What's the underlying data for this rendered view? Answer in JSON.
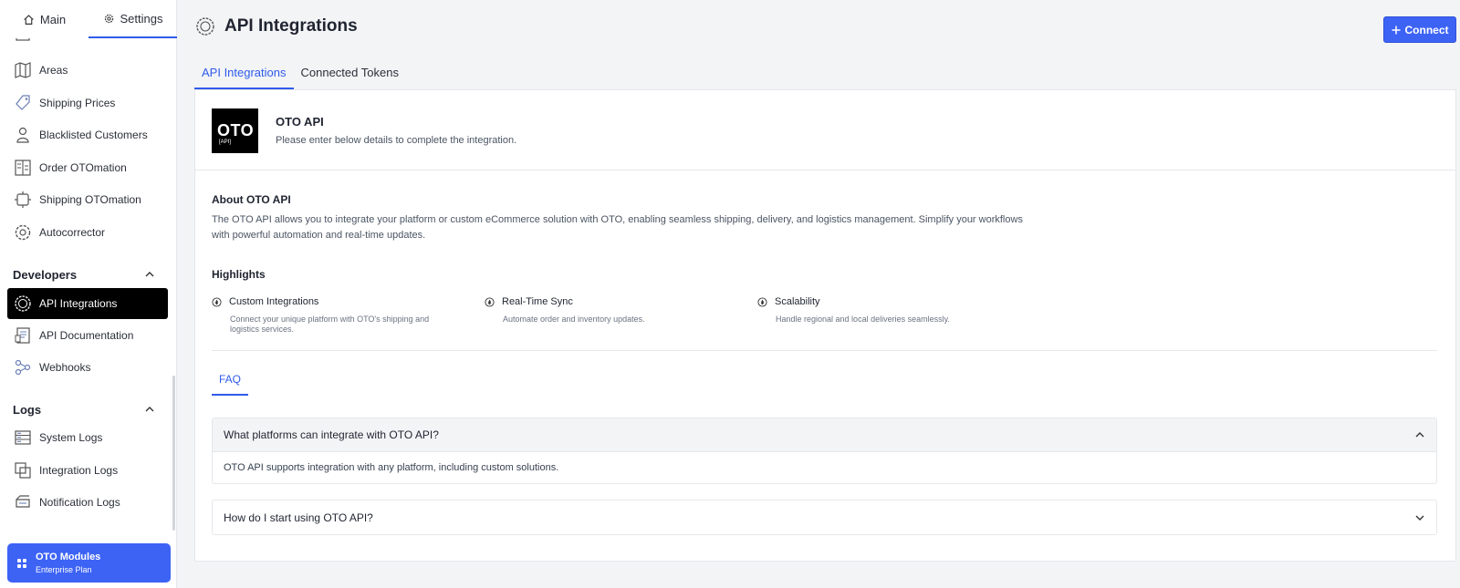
{
  "sidebar": {
    "tabs": [
      {
        "label": "Main",
        "icon": "home-icon",
        "active": false
      },
      {
        "label": "Settings",
        "icon": "gear-icon",
        "active": true
      }
    ],
    "items": [
      {
        "label": "Areas",
        "icon": "map-icon"
      },
      {
        "label": "Shipping Prices",
        "icon": "price-tag-icon"
      },
      {
        "label": "Blacklisted Customers",
        "icon": "user-block-icon"
      },
      {
        "label": "Order OTOmation",
        "icon": "order-automation-icon"
      },
      {
        "label": "Shipping OTOmation",
        "icon": "shipping-automation-icon"
      },
      {
        "label": "Autocorrector",
        "icon": "autocorrect-icon"
      }
    ],
    "developers": {
      "title": "Developers",
      "items": [
        {
          "label": "API Integrations",
          "icon": "api-icon",
          "active": true
        },
        {
          "label": "API Documentation",
          "icon": "document-icon"
        },
        {
          "label": "Webhooks",
          "icon": "webhook-icon"
        }
      ]
    },
    "logs": {
      "title": "Logs",
      "items": [
        {
          "label": "System Logs",
          "icon": "server-icon"
        },
        {
          "label": "Integration Logs",
          "icon": "integration-icon"
        },
        {
          "label": "Notification Logs",
          "icon": "notification-icon"
        }
      ]
    },
    "modules": {
      "title": "OTO Modules",
      "plan": "Enterprise Plan",
      "icon": "grid-icon"
    }
  },
  "header": {
    "title": "API Integrations",
    "connect_label": "Connect"
  },
  "content_tabs": [
    {
      "label": "API Integrations",
      "active": true
    },
    {
      "label": "Connected Tokens",
      "active": false
    }
  ],
  "integration": {
    "logo_text": "OTO",
    "logo_sub": "[API]",
    "title": "OTO API",
    "subtitle": "Please enter below details to complete the integration."
  },
  "about": {
    "title": "About OTO API",
    "body": "The OTO API allows you to integrate your platform or custom eCommerce solution with OTO, enabling seamless shipping, delivery, and logistics management. Simplify your workflows with powerful automation and real-time updates."
  },
  "highlights": {
    "title": "Highlights",
    "items": [
      {
        "title": "Custom Integrations",
        "desc": "Connect your unique platform with OTO's shipping and logistics services."
      },
      {
        "title": "Real-Time Sync",
        "desc": "Automate order and inventory updates."
      },
      {
        "title": "Scalability",
        "desc": "Handle regional and local deliveries seamlessly."
      }
    ]
  },
  "faq": {
    "tab_label": "FAQ",
    "items": [
      {
        "question": "What platforms can integrate with OTO API?",
        "answer": "OTO API supports integration with any platform, including custom solutions.",
        "expanded": true
      },
      {
        "question": "How do I start using OTO API?",
        "expanded": false
      }
    ]
  },
  "colors": {
    "accent": "#3d63f5",
    "active_nav_bg": "#000000",
    "page_bg": "#f3f4f6"
  }
}
